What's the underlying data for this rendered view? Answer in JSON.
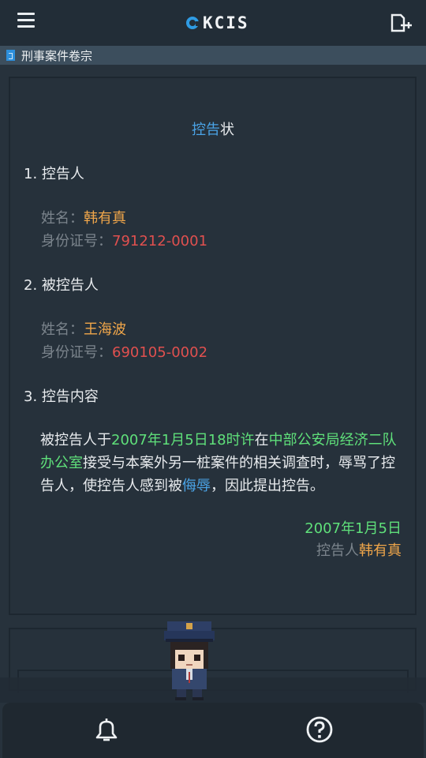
{
  "header": {
    "logo_text": "KCIS"
  },
  "breadcrumb": {
    "label": "刑事案件卷宗"
  },
  "document": {
    "title_highlight": "控告",
    "title_rest": "状",
    "section1": "1. 控告人",
    "complainant": {
      "name_label": "姓名：",
      "name": "韩有真",
      "id_label": "身份证号：",
      "id": "791212-0001"
    },
    "section2": "2. 被控告人",
    "accused": {
      "name_label": "姓名：",
      "name": "王海波",
      "id_label": "身份证号：",
      "id": "690105-0002"
    },
    "section3": "3. 控告内容",
    "content": {
      "p1": "被控告人于",
      "time": "2007年1月5日18时许",
      "p2": "在",
      "place": "中部公安局经济二队办公室",
      "p3": "接受与本案外另一桩案件的相关调查时，辱骂了控告人，使控告人感到被",
      "insult": "侮辱",
      "p4": "，因此提出控告。"
    },
    "date": "2007年1月5日",
    "signer_label": "控告人",
    "signer_name": "韩有真"
  },
  "colors": {
    "accent_blue": "#4aa3e6",
    "orange": "#f0a64a",
    "red": "#e0504f",
    "green": "#5fe07a"
  },
  "icons": {
    "menu": "menu-icon",
    "export": "export-icon",
    "doc": "document-icon",
    "bell": "bell-icon",
    "help": "help-icon"
  }
}
